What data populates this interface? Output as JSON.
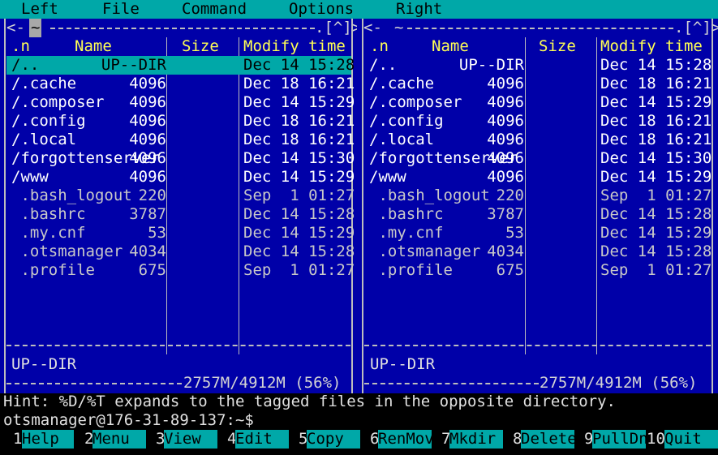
{
  "menu": {
    "left": "Left",
    "file": "File",
    "command": "Command",
    "options": "Options",
    "right": "Right"
  },
  "left_panel": {
    "path": "~",
    "history_marker": "<-",
    "nav_marker": ".[^]>",
    "headers": {
      "n": ".n",
      "name": "Name",
      "size": "Size",
      "modify": "Modify time"
    },
    "rows": [
      {
        "name": "/..",
        "size": "UP--DIR",
        "time": "Dec 14 15:28",
        "kind": "dir",
        "selected": true
      },
      {
        "name": "/.cache",
        "size": "4096",
        "time": "Dec 18 16:21",
        "kind": "dir",
        "selected": false
      },
      {
        "name": "/.composer",
        "size": "4096",
        "time": "Dec 14 15:29",
        "kind": "dir",
        "selected": false
      },
      {
        "name": "/.config",
        "size": "4096",
        "time": "Dec 18 16:21",
        "kind": "dir",
        "selected": false
      },
      {
        "name": "/.local",
        "size": "4096",
        "time": "Dec 18 16:21",
        "kind": "dir",
        "selected": false
      },
      {
        "name": "/forgottenserver",
        "size": "4096",
        "time": "Dec 14 15:30",
        "kind": "dir",
        "selected": false
      },
      {
        "name": "/www",
        "size": "4096",
        "time": "Dec 14 15:29",
        "kind": "dir",
        "selected": false
      },
      {
        "name": " .bash_logout",
        "size": "220",
        "time": "Sep  1 01:27",
        "kind": "file",
        "selected": false
      },
      {
        "name": " .bashrc",
        "size": "3787",
        "time": "Dec 14 15:28",
        "kind": "file",
        "selected": false
      },
      {
        "name": " .my.cnf",
        "size": "53",
        "time": "Dec 14 15:29",
        "kind": "file",
        "selected": false
      },
      {
        "name": " .otsmanager",
        "size": "4034",
        "time": "Dec 14 15:28",
        "kind": "file",
        "selected": false
      },
      {
        "name": " .profile",
        "size": "675",
        "time": "Sep  1 01:27",
        "kind": "file",
        "selected": false
      }
    ],
    "status": "UP--DIR",
    "disk": "2757M/4912M (56%)"
  },
  "right_panel": {
    "path": "~",
    "history_marker": "<-",
    "nav_marker": ".[^]>",
    "headers": {
      "n": ".n",
      "name": "Name",
      "size": "Size",
      "modify": "Modify time"
    },
    "rows": [
      {
        "name": "/..",
        "size": "UP--DIR",
        "time": "Dec 14 15:28",
        "kind": "dir",
        "selected": false
      },
      {
        "name": "/.cache",
        "size": "4096",
        "time": "Dec 18 16:21",
        "kind": "dir",
        "selected": false
      },
      {
        "name": "/.composer",
        "size": "4096",
        "time": "Dec 14 15:29",
        "kind": "dir",
        "selected": false
      },
      {
        "name": "/.config",
        "size": "4096",
        "time": "Dec 18 16:21",
        "kind": "dir",
        "selected": false
      },
      {
        "name": "/.local",
        "size": "4096",
        "time": "Dec 18 16:21",
        "kind": "dir",
        "selected": false
      },
      {
        "name": "/forgottenserver",
        "size": "4096",
        "time": "Dec 14 15:30",
        "kind": "dir",
        "selected": false
      },
      {
        "name": "/www",
        "size": "4096",
        "time": "Dec 14 15:29",
        "kind": "dir",
        "selected": false
      },
      {
        "name": " .bash_logout",
        "size": "220",
        "time": "Sep  1 01:27",
        "kind": "file",
        "selected": false
      },
      {
        "name": " .bashrc",
        "size": "3787",
        "time": "Dec 14 15:28",
        "kind": "file",
        "selected": false
      },
      {
        "name": " .my.cnf",
        "size": "53",
        "time": "Dec 14 15:29",
        "kind": "file",
        "selected": false
      },
      {
        "name": " .otsmanager",
        "size": "4034",
        "time": "Dec 14 15:28",
        "kind": "file",
        "selected": false
      },
      {
        "name": " .profile",
        "size": "675",
        "time": "Sep  1 01:27",
        "kind": "file",
        "selected": false
      }
    ],
    "status": "UP--DIR",
    "disk": "2757M/4912M (56%)"
  },
  "hint": "Hint: %D/%T expands to the tagged files in the opposite directory.",
  "prompt": "otsmanager@176-31-89-137:~$",
  "fkeys": [
    {
      "num": "1",
      "label": "Help"
    },
    {
      "num": "2",
      "label": "Menu"
    },
    {
      "num": "3",
      "label": "View"
    },
    {
      "num": "4",
      "label": "Edit"
    },
    {
      "num": "5",
      "label": "Copy"
    },
    {
      "num": "6",
      "label": "RenMov"
    },
    {
      "num": "7",
      "label": "Mkdir"
    },
    {
      "num": "8",
      "label": "Delete"
    },
    {
      "num": "9",
      "label": "PullDn"
    },
    {
      "num": "10",
      "label": "Quit"
    }
  ],
  "colors": {
    "panel_bg": "#0000a8",
    "menubar_bg": "#00a8a8",
    "header_fg": "#ffff54",
    "selection_bg": "#00a8a8"
  }
}
